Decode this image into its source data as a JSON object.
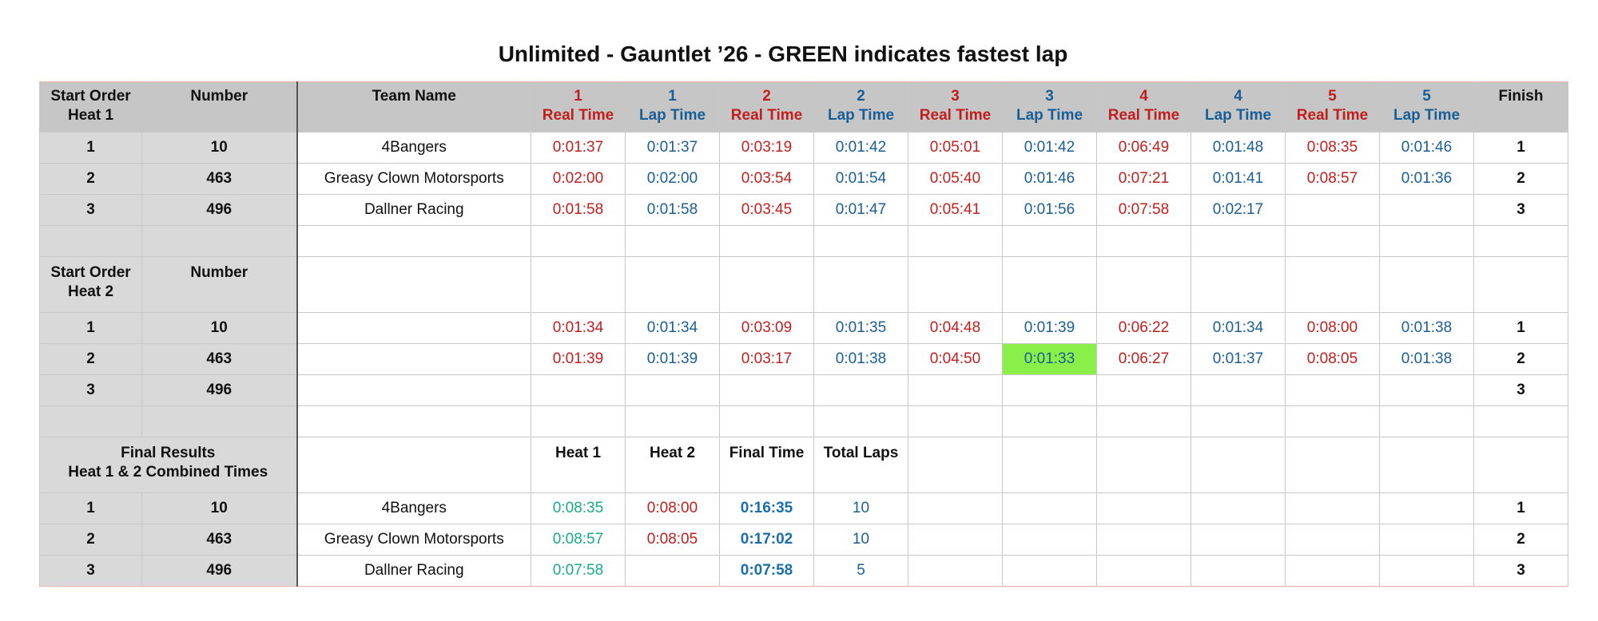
{
  "title": "Unlimited  - Gauntlet ’26  - GREEN indicates fastest lap",
  "header": {
    "start_order_l1": "Start Order",
    "start_order_l2": "Heat 1",
    "number": "Number",
    "team_name": "Team Name",
    "cols": [
      {
        "n": "1",
        "t": "Real Time"
      },
      {
        "n": "1",
        "t": "Lap Time"
      },
      {
        "n": "2",
        "t": "Real Time"
      },
      {
        "n": "2",
        "t": "Lap Time"
      },
      {
        "n": "3",
        "t": "Real Time"
      },
      {
        "n": "3",
        "t": "Lap Time"
      },
      {
        "n": "4",
        "t": "Real Time"
      },
      {
        "n": "4",
        "t": "Lap Time"
      },
      {
        "n": "5",
        "t": "Real Time"
      },
      {
        "n": "5",
        "t": "Lap Time"
      }
    ],
    "finish": "Finish"
  },
  "heat1": [
    {
      "start": "1",
      "number": "10",
      "team": "4Bangers",
      "times": [
        "0:01:37",
        "0:01:37",
        "0:03:19",
        "0:01:42",
        "0:05:01",
        "0:01:42",
        "0:06:49",
        "0:01:48",
        "0:08:35",
        "0:01:46"
      ],
      "finish": "1"
    },
    {
      "start": "2",
      "number": "463",
      "team": "Greasy Clown Motorsports",
      "times": [
        "0:02:00",
        "0:02:00",
        "0:03:54",
        "0:01:54",
        "0:05:40",
        "0:01:46",
        "0:07:21",
        "0:01:41",
        "0:08:57",
        "0:01:36"
      ],
      "finish": "2"
    },
    {
      "start": "3",
      "number": "496",
      "team": "Dallner Racing",
      "times": [
        "0:01:58",
        "0:01:58",
        "0:03:45",
        "0:01:47",
        "0:05:41",
        "0:01:56",
        "0:07:58",
        "0:02:17",
        "",
        ""
      ],
      "finish": "3"
    }
  ],
  "heat2_header": {
    "start_order_l1": "Start Order",
    "start_order_l2": "Heat 2",
    "number": "Number"
  },
  "heat2": [
    {
      "start": "1",
      "number": "10",
      "team": "",
      "times": [
        "0:01:34",
        "0:01:34",
        "0:03:09",
        "0:01:35",
        "0:04:48",
        "0:01:39",
        "0:06:22",
        "0:01:34",
        "0:08:00",
        "0:01:38"
      ],
      "finish": "1"
    },
    {
      "start": "2",
      "number": "463",
      "team": "",
      "times": [
        "0:01:39",
        "0:01:39",
        "0:03:17",
        "0:01:38",
        "0:04:50",
        "0:01:33",
        "0:06:27",
        "0:01:37",
        "0:08:05",
        "0:01:38"
      ],
      "finish": "2"
    },
    {
      "start": "3",
      "number": "496",
      "team": "",
      "times": [
        "",
        "",
        "",
        "",
        "",
        "",
        "",
        "",
        "",
        ""
      ],
      "finish": "3"
    }
  ],
  "fastest_lap_color": "#8af049",
  "final_header": {
    "label_l1": "Final Results",
    "label_l2": "Heat 1 & 2 Combined Times",
    "heat1": "Heat 1",
    "heat2": "Heat 2",
    "final_time": "Final Time",
    "total_laps": "Total Laps"
  },
  "final": [
    {
      "start": "1",
      "number": "10",
      "team": "4Bangers",
      "heat1": "0:08:35",
      "heat2": "0:08:00",
      "final_time": "0:16:35",
      "total_laps": "10",
      "finish": "1"
    },
    {
      "start": "2",
      "number": "463",
      "team": "Greasy Clown Motorsports",
      "heat1": "0:08:57",
      "heat2": "0:08:05",
      "final_time": "0:17:02",
      "total_laps": "10",
      "finish": "2"
    },
    {
      "start": "3",
      "number": "496",
      "team": "Dallner Racing",
      "heat1": "0:07:58",
      "heat2": "",
      "final_time": "0:07:58",
      "total_laps": "5",
      "finish": "3"
    }
  ]
}
